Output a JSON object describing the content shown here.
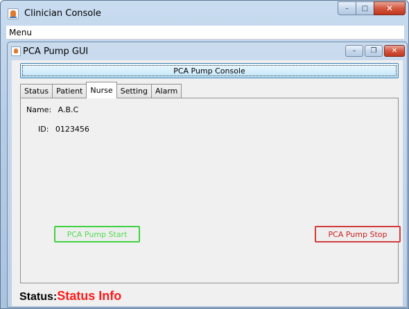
{
  "outer_window": {
    "title": "Clinician Console",
    "minimize_glyph": "–",
    "maximize_glyph": "□",
    "close_glyph": "✕"
  },
  "menubar": {
    "menu_label": "Menu"
  },
  "inner_window": {
    "title": "PCA Pump GUI",
    "minimize_glyph": "–",
    "restore_glyph": "❐",
    "close_glyph": "✕"
  },
  "console_bar": {
    "label": "PCA Pump Console"
  },
  "tabs": [
    {
      "label": "Status",
      "active": false
    },
    {
      "label": "Patient",
      "active": false
    },
    {
      "label": "Nurse",
      "active": true
    },
    {
      "label": "Setting",
      "active": false
    },
    {
      "label": "Alarm",
      "active": false
    }
  ],
  "nurse": {
    "name_label": "Name:",
    "name_value": "A.B.C",
    "id_label": "ID:",
    "id_value": "0123456"
  },
  "buttons": {
    "start_label": "PCA Pump Start",
    "stop_label": "PCA Pump Stop",
    "start_color": "#3fd23f",
    "stop_color": "#d23a3a"
  },
  "status": {
    "label": "Status:",
    "value": "Status Info",
    "value_color": "#ff1a1a"
  }
}
